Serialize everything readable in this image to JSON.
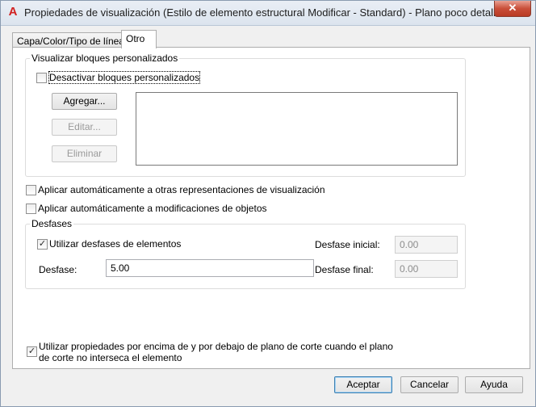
{
  "window": {
    "title": "Propiedades de visualización (Estilo de elemento estructural Modificar - Standard) - Plano poco detallado",
    "app_icon_glyph": "A",
    "close_glyph": "✕"
  },
  "tabs": [
    {
      "label": "Capa/Color/Tipo de línea",
      "active": false
    },
    {
      "label": "Otro",
      "active": true
    }
  ],
  "custom_blocks": {
    "group_label": "Visualizar bloques personalizados",
    "disable_checkbox": {
      "label": "Desactivar bloques personalizados",
      "checked": false
    },
    "add_button": "Agregar...",
    "edit_button": "Editar...",
    "delete_button": "Eliminar"
  },
  "apply_other_reps": {
    "label": "Aplicar automáticamente a otras representaciones de visualización",
    "checked": false
  },
  "apply_object_mods": {
    "label": "Aplicar automáticamente a modificaciones de objetos",
    "checked": false
  },
  "offsets": {
    "group_label": "Desfases",
    "use_member_offsets": {
      "label": "Utilizar desfases de elementos",
      "checked": true
    },
    "offset_label": "Desfase:",
    "offset_value": "5.00",
    "start_offset_label": "Desfase inicial:",
    "start_offset_value": "0.00",
    "end_offset_label": "Desfase final:",
    "end_offset_value": "0.00"
  },
  "cut_plane": {
    "label_line1": "Utilizar propiedades por encima de y por debajo de plano de corte cuando el plano",
    "label_line2": "de corte no interseca el elemento",
    "checked": true
  },
  "footer": {
    "ok": "Aceptar",
    "cancel": "Cancelar",
    "help": "Ayuda"
  },
  "colors": {
    "accent": "#3c7fb1",
    "app_icon": "#d12020",
    "close_button": "#c94f3a"
  }
}
